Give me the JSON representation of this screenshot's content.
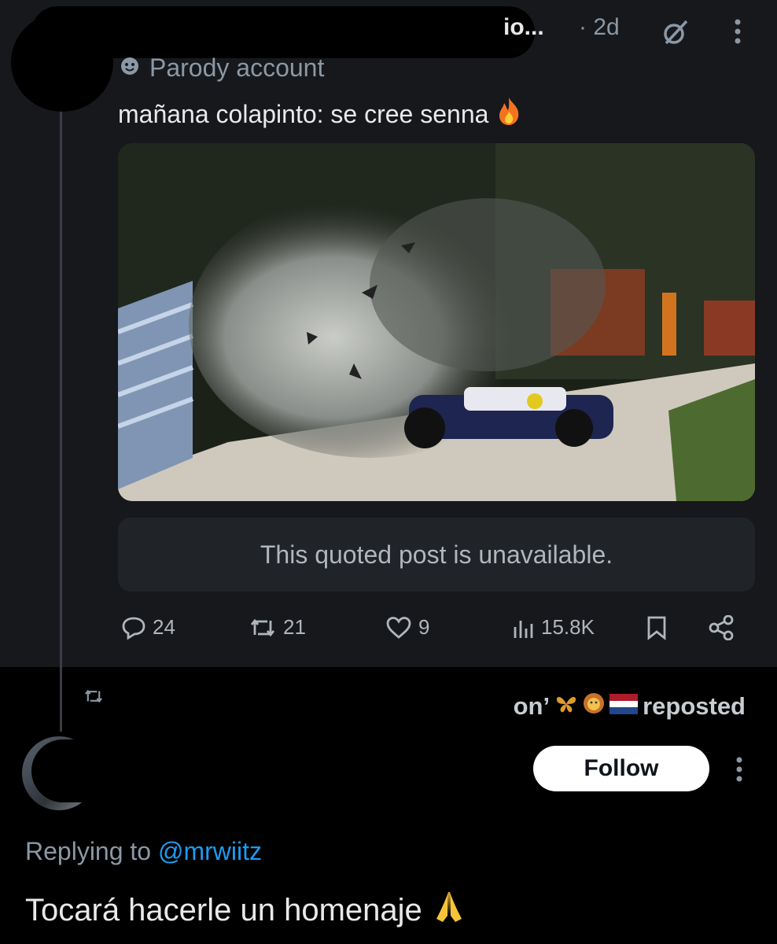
{
  "post": {
    "name_visible": "io...",
    "time": "· 2d",
    "badge": "Parody account",
    "text": "mañana colapinto: se cree senna",
    "image_alt": "Racing car crash against a wall with debris and smoke",
    "quoted_unavailable": "This quoted post is unavailable.",
    "stats": {
      "replies": "24",
      "reposts": "21",
      "likes": "9",
      "views": "15.8K"
    }
  },
  "repost": {
    "name_tail": "on’",
    "label": "reposted"
  },
  "reply": {
    "follow_label": "Follow",
    "replying_prefix": "Replying to",
    "replying_handle": "@mrwiitz",
    "text": "Tocará hacerle un homenaje"
  },
  "colors": {
    "background": "#000000",
    "card": "#16181c",
    "muted": "#8b98a5",
    "link": "#1d9bf0"
  }
}
